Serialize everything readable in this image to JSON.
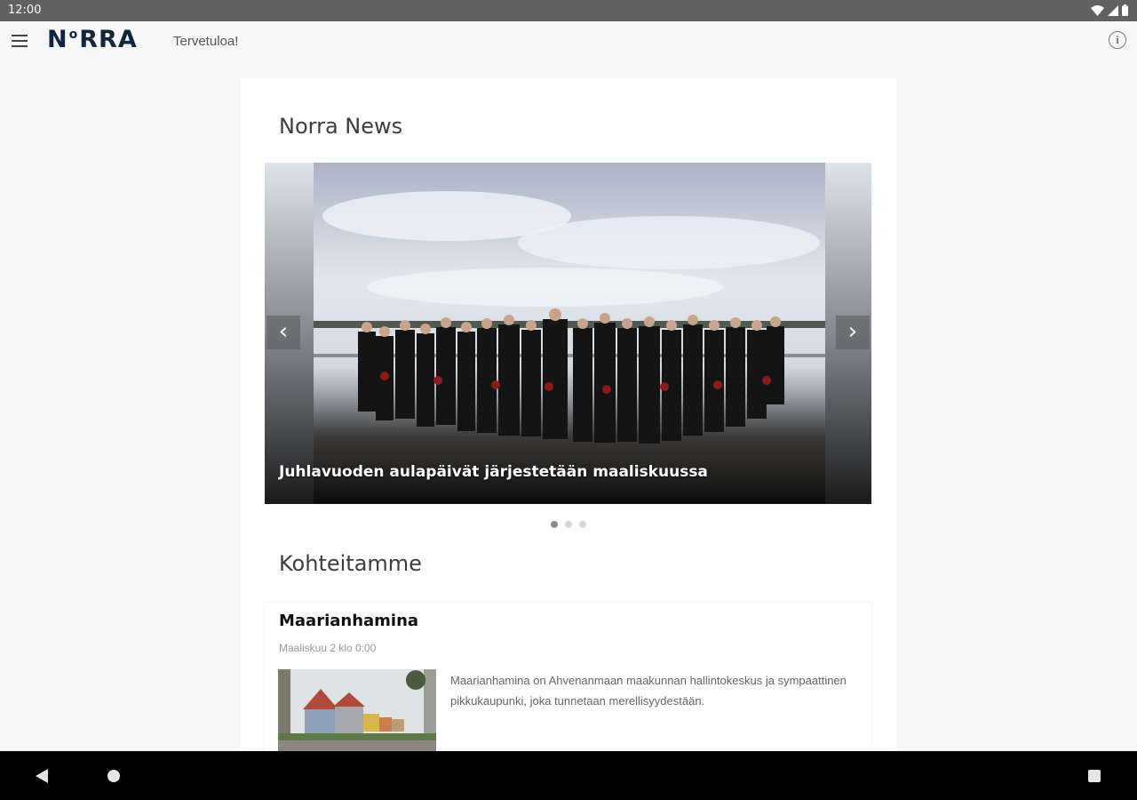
{
  "status_bar": {
    "time": "12:00"
  },
  "app_bar": {
    "logo_text_n": "N",
    "logo_text_o": "o",
    "logo_text_rest": "RRA",
    "subtitle": "Tervetuloa!",
    "info_glyph": "i"
  },
  "news": {
    "title": "Norra News",
    "slide_caption": "Juhlavuoden aulapäivät järjestetään maaliskuussa",
    "prev_glyph": "‹",
    "next_glyph": "›",
    "slide_count": 3,
    "active_slide": 1
  },
  "destinations": {
    "title": "Kohteitamme",
    "items": [
      {
        "name": "Maarianhamina",
        "date": "Maaliskuu 2 klo 0:00",
        "description": "Maarianhamina on Ahvenanmaan maakunnan hallintokeskus ja sympaattinen pikkukaupunki, joka tunnetaan merellisyydestään."
      }
    ]
  },
  "colors": {
    "logo": "#0f2540",
    "status_bar": "#616161",
    "nav_bar": "#000000",
    "dot_active": "#8c8c8c",
    "dot_inactive": "#d6d6d6"
  },
  "icons": {
    "menu": "menu-icon",
    "info": "info-icon",
    "wifi": "wifi-icon",
    "signal": "signal-icon",
    "battery": "battery-icon",
    "back": "back-icon",
    "home": "home-icon",
    "recent": "recent-apps-icon"
  }
}
